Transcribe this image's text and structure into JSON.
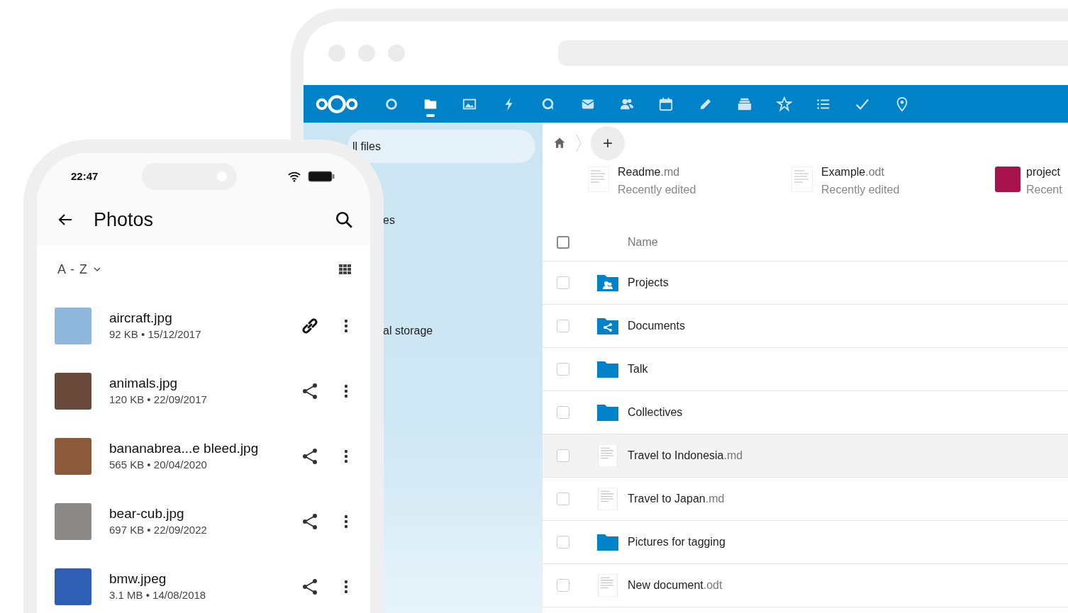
{
  "browser": {
    "app_nav": [
      {
        "kind": "dashboard",
        "selected": false
      },
      {
        "kind": "files",
        "selected": true
      },
      {
        "kind": "photos",
        "selected": false
      },
      {
        "kind": "activity",
        "selected": false
      },
      {
        "kind": "talk",
        "selected": false
      },
      {
        "kind": "mail",
        "selected": false
      },
      {
        "kind": "contacts",
        "selected": false
      },
      {
        "kind": "calendar",
        "selected": false
      },
      {
        "kind": "notes",
        "selected": false
      },
      {
        "kind": "deck",
        "selected": false
      },
      {
        "kind": "star",
        "selected": false
      },
      {
        "kind": "tasks",
        "selected": false
      },
      {
        "kind": "check",
        "selected": false
      },
      {
        "kind": "maps",
        "selected": false
      }
    ],
    "sidebar": {
      "items": [
        {
          "label": "ll files",
          "selected": true
        },
        {
          "label": "es",
          "selected": false
        },
        {
          "label": "al storage",
          "selected": false
        }
      ]
    },
    "breadcrumb": {
      "new_button": "+"
    },
    "recent": [
      {
        "name": "Readme",
        "ext": ".md",
        "note": "Recently edited",
        "kind": "document"
      },
      {
        "name": "Example",
        "ext": ".odt",
        "note": "Recently edited",
        "kind": "document"
      },
      {
        "name": "project",
        "note": "Recent",
        "kind": "image"
      }
    ],
    "table": {
      "header": "Name",
      "all_selected": false,
      "rows": [
        {
          "name": "Projects",
          "ext": "",
          "kind": "group-folder",
          "highlighted": false
        },
        {
          "name": "Documents",
          "ext": "",
          "kind": "shared-folder",
          "highlighted": false
        },
        {
          "name": "Talk",
          "ext": "",
          "kind": "folder",
          "highlighted": false
        },
        {
          "name": "Collectives",
          "ext": "",
          "kind": "folder",
          "highlighted": false
        },
        {
          "name": "Travel to Indonesia",
          "ext": ".md",
          "kind": "document",
          "highlighted": true
        },
        {
          "name": "Travel to Japan",
          "ext": ".md",
          "kind": "document",
          "highlighted": false
        },
        {
          "name": "Pictures for tagging",
          "ext": "",
          "kind": "folder",
          "highlighted": false
        },
        {
          "name": "New document",
          "ext": ".odt",
          "kind": "document",
          "highlighted": false
        }
      ]
    }
  },
  "phone": {
    "time": "22:47",
    "title": "Photos",
    "sort": "A - Z",
    "files": [
      {
        "name": "aircraft.jpg",
        "meta": "92 KB • 15/12/2017",
        "kind": "link",
        "color": "#8fb6dc"
      },
      {
        "name": "animals.jpg",
        "meta": "120 KB • 22/09/2017",
        "kind": "share",
        "color": "#6a4a3a"
      },
      {
        "name": "bananabrea...e bleed.jpg",
        "meta": "565 KB • 20/04/2020",
        "kind": "share",
        "color": "#8a5a3a"
      },
      {
        "name": "bear-cub.jpg",
        "meta": "697 KB • 22/09/2022",
        "kind": "share",
        "color": "#8c8a86"
      },
      {
        "name": "bmw.jpeg",
        "meta": "3.1 MB • 14/08/2018",
        "kind": "share",
        "color": "#2f5fb5"
      }
    ]
  }
}
